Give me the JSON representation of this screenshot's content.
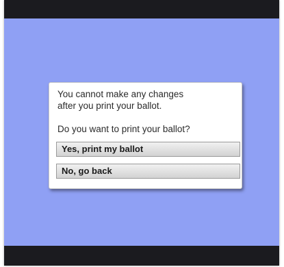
{
  "dialog": {
    "message_line1": "You cannot make any changes",
    "message_line2": "after you print your ballot.",
    "question": "Do you want to print your ballot?",
    "confirm_label": "Yes, print my ballot",
    "cancel_label": "No, go back"
  },
  "colors": {
    "background": "#8fa0f4",
    "bars": "#1b1b1f",
    "dialog": "#ffffff"
  }
}
